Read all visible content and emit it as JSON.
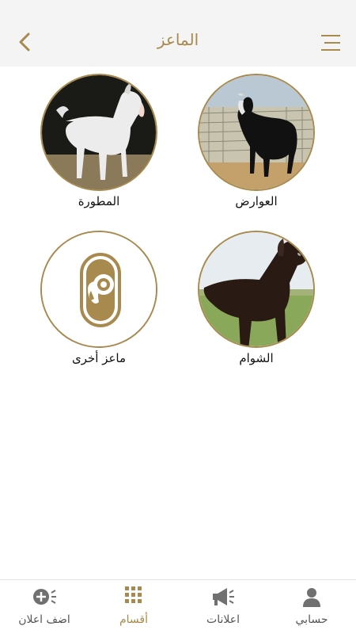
{
  "header": {
    "title": "الماعز"
  },
  "categories": [
    {
      "label": "العوارض",
      "icon": "goat-photo-black-longhair"
    },
    {
      "label": "المطورة",
      "icon": "goat-photo-white"
    },
    {
      "label": "الشوام",
      "icon": "goat-photo-brown"
    },
    {
      "label": "ماعز أخرى",
      "icon": "ram-logo-icon"
    }
  ],
  "bottom_nav": {
    "items": [
      {
        "label": "حسابي",
        "icon": "user-icon"
      },
      {
        "label": "اعلانات",
        "icon": "megaphone-icon"
      },
      {
        "label": "أقسام",
        "icon": "grid-icon",
        "active": true
      },
      {
        "label": "اضف اعلان",
        "icon": "add-ad-icon"
      }
    ]
  },
  "colors": {
    "accent": "#a88a4e",
    "header_bg": "#f4f4f4"
  }
}
